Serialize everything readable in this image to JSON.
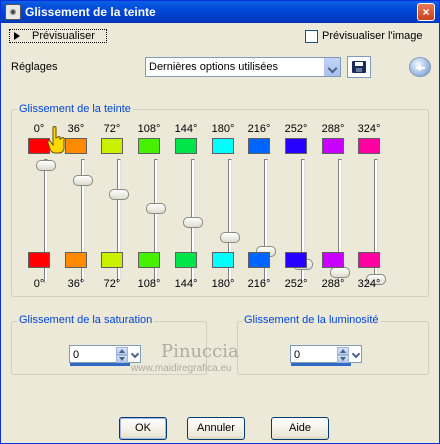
{
  "window": {
    "title": "Glissement de la teinte",
    "close_label": "×"
  },
  "preview_button_label": "Prévisualiser",
  "preview_image_checkbox_label": "Prévisualiser l'image",
  "settings": {
    "label": "Réglages",
    "selected": "Dernières options utilisées"
  },
  "hue_group": {
    "title": "Glissement de la teinte",
    "channels": [
      {
        "top_label": "0°",
        "bottom_label": "0°",
        "top_color": "#ff0000",
        "bottom_color": "#ff0000",
        "slider_level": 0.94
      },
      {
        "top_label": "36°",
        "bottom_label": "36°",
        "top_color": "#ff8c00",
        "bottom_color": "#ff8c00",
        "slider_level": 0.82
      },
      {
        "top_label": "72°",
        "bottom_label": "72°",
        "top_color": "#c8f000",
        "bottom_color": "#c8f000",
        "slider_level": 0.7
      },
      {
        "top_label": "108°",
        "bottom_label": "108°",
        "top_color": "#46f000",
        "bottom_color": "#46f000",
        "slider_level": 0.59
      },
      {
        "top_label": "144°",
        "bottom_label": "144°",
        "top_color": "#00e64a",
        "bottom_color": "#00e64a",
        "slider_level": 0.47
      },
      {
        "top_label": "180°",
        "bottom_label": "180°",
        "top_color": "#00ffff",
        "bottom_color": "#00ffff",
        "slider_level": 0.35
      },
      {
        "top_label": "216°",
        "bottom_label": "216°",
        "top_color": "#0064ff",
        "bottom_color": "#0064ff",
        "slider_level": 0.23
      },
      {
        "top_label": "252°",
        "bottom_label": "252°",
        "top_color": "#2800ff",
        "bottom_color": "#2800ff",
        "slider_level": 0.12
      },
      {
        "top_label": "288°",
        "bottom_label": "288°",
        "top_color": "#c800ff",
        "bottom_color": "#c800ff",
        "slider_level": 0.06
      },
      {
        "top_label": "324°",
        "bottom_label": "324°",
        "top_color": "#ff00a0",
        "bottom_color": "#ff00a0",
        "slider_level": 0.0
      }
    ]
  },
  "saturation": {
    "title": "Glissement de la saturation",
    "value": "0"
  },
  "luminosity": {
    "title": "Glissement de la luminosité",
    "value": "0"
  },
  "watermark": {
    "name": "Pinuccia",
    "url": "www.maidiregrafica.eu"
  },
  "buttons": {
    "ok": "OK",
    "cancel": "Annuler",
    "help": "Aide"
  },
  "colors": {
    "title_bar": "#0046d5",
    "group_title": "#0046d5",
    "dialog_bg": "#ece9d8"
  }
}
